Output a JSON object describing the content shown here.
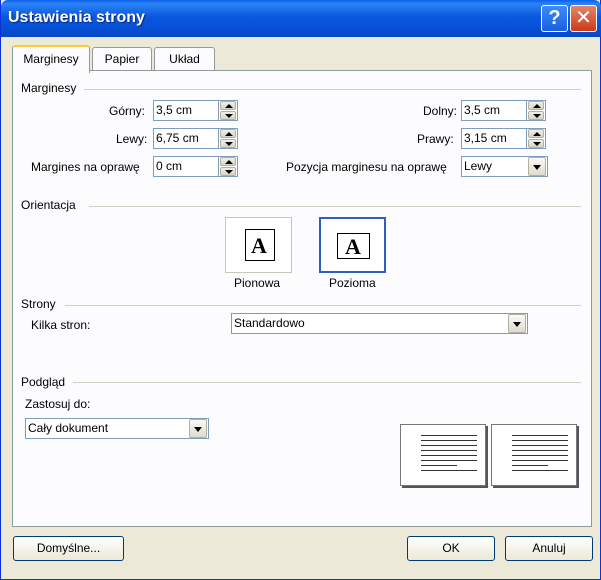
{
  "window": {
    "title": "Ustawienia strony"
  },
  "tabs": [
    {
      "label": "Marginesy"
    },
    {
      "label": "Papier"
    },
    {
      "label": "Układ"
    }
  ],
  "margins": {
    "section_label": "Marginesy",
    "top": {
      "label": "Górny:",
      "value": "3,5 cm"
    },
    "bottom": {
      "label": "Dolny:",
      "value": "3,5 cm"
    },
    "left": {
      "label": "Lewy:",
      "value": "6,75 cm"
    },
    "right": {
      "label": "Prawy:",
      "value": "3,15 cm"
    },
    "gutter": {
      "label": "Margines na oprawę",
      "value": "0 cm"
    },
    "gutter_pos": {
      "label": "Pozycja marginesu na oprawę",
      "value": "Lewy"
    }
  },
  "orientation": {
    "section_label": "Orientacja",
    "portrait": {
      "label": "Pionowa",
      "glyph": "A"
    },
    "landscape": {
      "label": "Pozioma",
      "glyph": "A",
      "selected": true
    }
  },
  "pages": {
    "section_label": "Strony",
    "multiple_label": "Kilka stron:",
    "multiple_value": "Standardowo"
  },
  "preview": {
    "section_label": "Podgląd",
    "apply_label": "Zastosuj do:",
    "apply_value": "Cały dokument"
  },
  "buttons": {
    "default": "Domyślne...",
    "ok": "OK",
    "cancel": "Anuluj"
  },
  "colors": {
    "titlebar": "#0a58df",
    "dialog_bg": "#ece9d8",
    "panel_bg": "#fcfcfe",
    "field_border": "#7f9db9"
  }
}
